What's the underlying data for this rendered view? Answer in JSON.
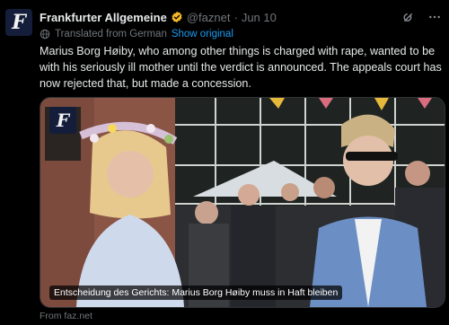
{
  "tweet": {
    "author_name": "Frankfurter Allgemeine",
    "handle": "@faznet",
    "separator": "·",
    "time": "Jun 10",
    "avatar_glyph": "F",
    "translated_label": "Translated from German",
    "show_original_label": "Show original",
    "text": "Marius Borg Høiby, who among other things is charged with rape, wanted to be with his seriously ill mother until the verdict is announced. The appeals court has now rejected that, but made a concession.",
    "icons": {
      "verified": "verified-badge-icon",
      "grok": "grok-icon",
      "more": "more-options-icon",
      "globe": "globe-icon"
    }
  },
  "media": {
    "logo_glyph": "F",
    "caption": "Entscheidung des Gerichts: Marius Borg Høiby muss in Haft bleiben"
  },
  "source": "From faz.net",
  "colors": {
    "background": "#000000",
    "text": "#e7e9ea",
    "muted": "#71767b",
    "link": "#1d9bf0",
    "verified": "#f7b928",
    "fazblue": "#141d3a"
  }
}
